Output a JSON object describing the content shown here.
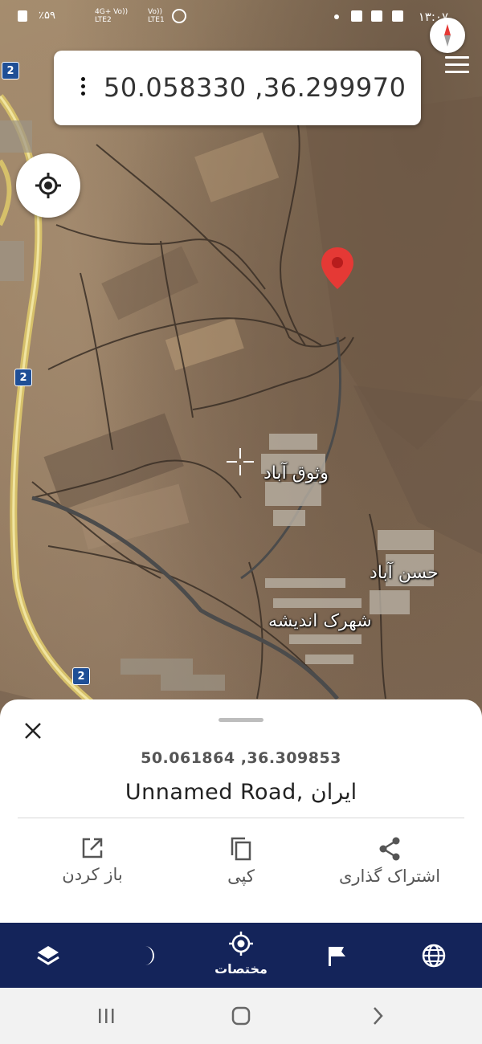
{
  "status_bar": {
    "battery": "٪۵۹",
    "sim1": "4G+ Vo))\nLTE2",
    "sim2": "Vo))\nLTE1",
    "time": "۱۳:۰۷"
  },
  "coord_box": {
    "coordinates": "50.058330 ,36.299970",
    "menu_icon": "kebab-icon"
  },
  "map": {
    "labels": {
      "vosugh_abad": "وثوق آباد",
      "hasan_abad": "حسن آباد",
      "shahrak_andisheh": "شهرک اندیشه"
    },
    "road_shield": "2"
  },
  "sheet": {
    "coordinates": "50.061864 ,36.309853",
    "address": "Unnamed Road, ایران",
    "actions": {
      "open": "باز کردن",
      "copy": "کپی",
      "share": "اشتراک گذاری"
    }
  },
  "bottom_nav": {
    "coordinates_label": "مختصات",
    "icons": [
      "layers-icon",
      "moon-icon",
      "crosshair-icon",
      "flag-icon",
      "globe-icon"
    ]
  },
  "colors": {
    "nav_bg": "#14245a",
    "pin_red": "#e53935",
    "road_yellow": "#e8d27a"
  }
}
